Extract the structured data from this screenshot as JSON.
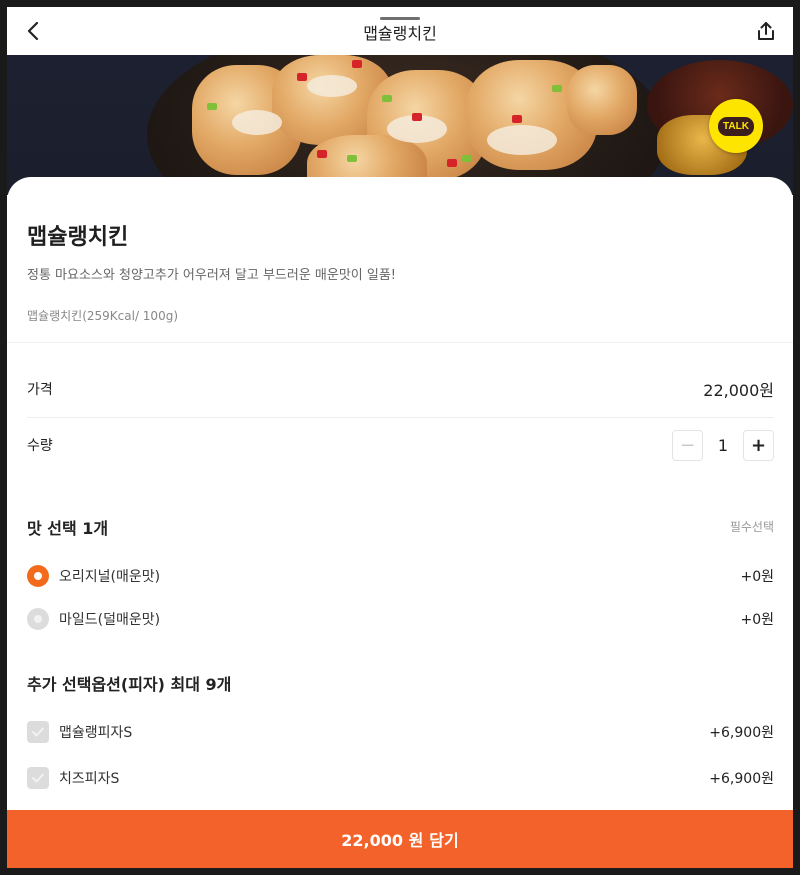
{
  "header": {
    "title": "맵슐랭치킨"
  },
  "kakao": {
    "label": "TALK"
  },
  "product": {
    "name": "맵슐랭치킨",
    "description": "정통 마요소스와 청양고추가 어우러져 달고 부드러운 매운맛이 일품!",
    "nutrition": "맵슐랭치킨(259Kcal/ 100g)"
  },
  "price": {
    "label": "가격",
    "value": "22,000원"
  },
  "quantity": {
    "label": "수량",
    "value": "1",
    "minus": "−",
    "plus": "+"
  },
  "flavor": {
    "title": "맛 선택 1개",
    "required": "필수선택",
    "options": [
      {
        "label": "오리지널(매운맛)",
        "price": "+0원",
        "selected": true
      },
      {
        "label": "마일드(덜매운맛)",
        "price": "+0원",
        "selected": false
      }
    ]
  },
  "extra": {
    "title": "추가 선택옵션(피자) 최대 9개",
    "options": [
      {
        "label": "맵슐랭피자S",
        "price": "+6,900원"
      },
      {
        "label": "치즈피자S",
        "price": "+6,900원"
      }
    ]
  },
  "cta": {
    "amount": "22,000 원",
    "action": "담기"
  },
  "colors": {
    "accent": "#f26b1d",
    "cta": "#f2622a",
    "kakao": "#fee500"
  }
}
